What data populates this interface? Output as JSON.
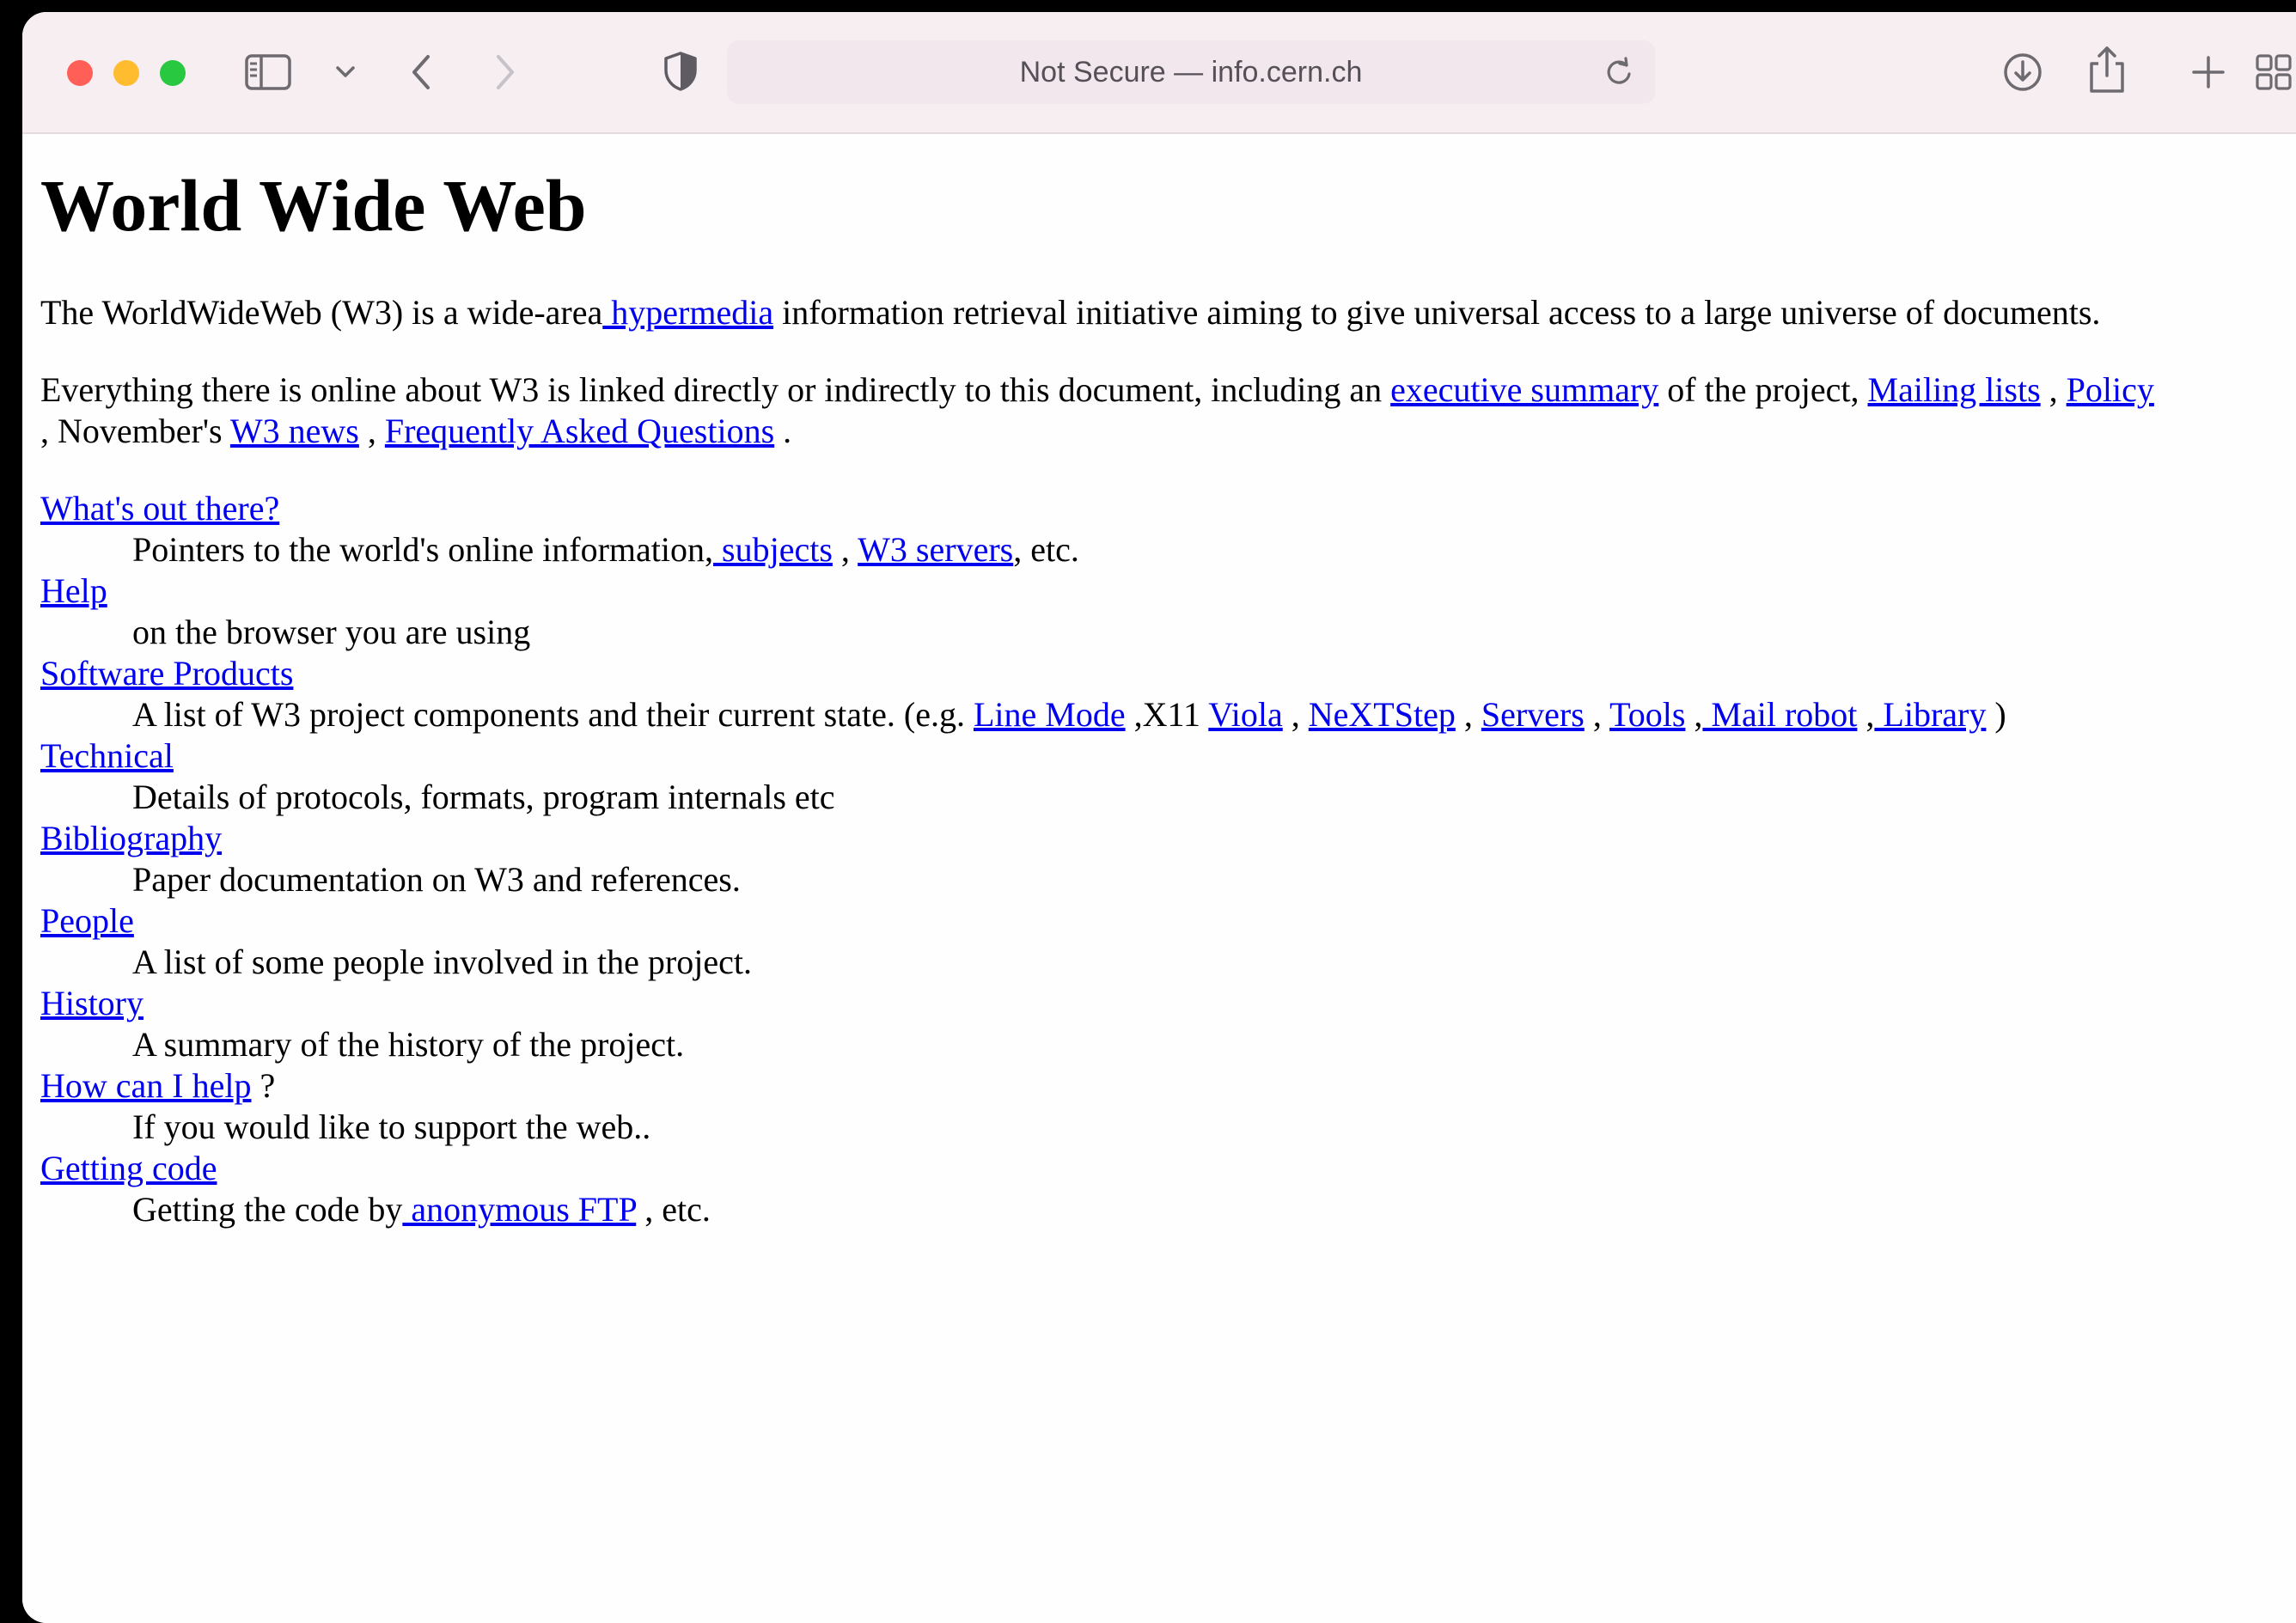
{
  "browser": {
    "address": "Not Secure — info.cern.ch",
    "traffic_lights": {
      "close": "#ff5f57",
      "minimize": "#febc2e",
      "maximize": "#28c840"
    },
    "icons": [
      "sidebar-icon",
      "chevron-down-icon",
      "back-icon",
      "forward-icon",
      "shield-icon",
      "reload-icon",
      "download-icon",
      "share-icon",
      "new-tab-icon",
      "tab-overview-icon"
    ]
  },
  "page": {
    "title": "World Wide Web",
    "intro": {
      "t1": "The WorldWideWeb (W3) is a wide-area",
      "link_hypermedia": " hypermedia",
      "t2": " information retrieval initiative aiming to give universal access to a large universe of documents."
    },
    "everything": {
      "t1": "Everything there is online about W3 is linked directly or indirectly to this document, including an ",
      "link_executive_summary": "executive summary",
      "t2": " of the project, ",
      "link_mailing_lists": "Mailing lists",
      "t3": " , ",
      "link_policy": "Policy",
      "t4": ", November's ",
      "link_w3_news": "W3 news",
      "t5": " , ",
      "link_faq": "Frequently Asked Questions",
      "t6": " ."
    },
    "whats_out_there": {
      "link": "What's out there?",
      "d1": "Pointers to the world's online information,",
      "link_subjects": " subjects",
      "d2": " , ",
      "link_w3_servers": "W3 servers",
      "d3": ", etc."
    },
    "help": {
      "link": "Help",
      "desc": "on the browser you are using"
    },
    "software_products": {
      "link": "Software Products",
      "d1": "A list of W3 project components and their current state. (e.g. ",
      "link_line_mode": "Line Mode",
      "d2": " ,X11 ",
      "link_viola": "Viola",
      "d3": " , ",
      "link_nextstep": "NeXTStep",
      "d4": " , ",
      "link_servers": "Servers",
      "d5": " , ",
      "link_tools": "Tools",
      "d6": " ,",
      "link_mail_robot": " Mail robot",
      "d7": " ,",
      "link_library": " Library",
      "d8": " )"
    },
    "technical": {
      "link": "Technical",
      "desc": "Details of protocols, formats, program internals etc"
    },
    "bibliography": {
      "link": "Bibliography",
      "desc": "Paper documentation on W3 and references."
    },
    "people": {
      "link": "People",
      "desc": "A list of some people involved in the project."
    },
    "history": {
      "link": "History",
      "desc": "A summary of the history of the project."
    },
    "how_can_i_help": {
      "link": "How can I help",
      "suffix": " ?",
      "desc": "If you would like to support the web.."
    },
    "getting_code": {
      "link": "Getting code",
      "d1": "Getting the code by",
      "link_ftp": " anonymous FTP",
      "d2": " , etc."
    }
  }
}
